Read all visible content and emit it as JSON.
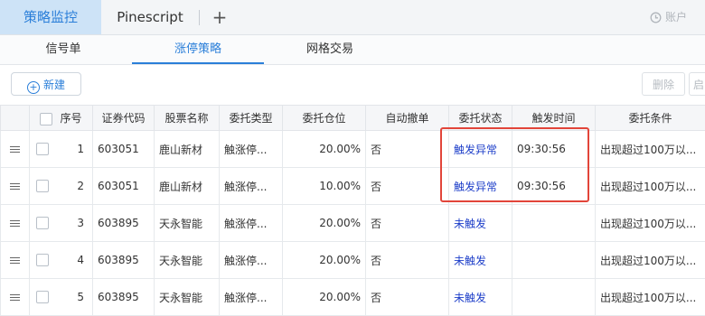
{
  "tabs": {
    "active_label": "策略监控",
    "pine_label": "Pinescript",
    "add_label": "+",
    "account_label": "账户"
  },
  "subtabs": [
    "信号单",
    "涨停策略",
    "网格交易"
  ],
  "toolbar": {
    "new_label": "新建",
    "delete_label": "删除",
    "partial_label": "启"
  },
  "table": {
    "headers": [
      "",
      "序号",
      "证券代码",
      "股票名称",
      "委托类型",
      "委托仓位",
      "自动撤单",
      "委托状态",
      "触发时间",
      "委托条件"
    ],
    "rows": [
      {
        "no": "1",
        "code": "603051",
        "name": "鹿山新材",
        "type": "触涨停...",
        "position": "20.00%",
        "auto_cancel": "否",
        "status": "触发异常",
        "time": "09:30:56",
        "condition": "出现超过100万以..."
      },
      {
        "no": "2",
        "code": "603051",
        "name": "鹿山新材",
        "type": "触涨停...",
        "position": "10.00%",
        "auto_cancel": "否",
        "status": "触发异常",
        "time": "09:30:56",
        "condition": "出现超过100万以..."
      },
      {
        "no": "3",
        "code": "603895",
        "name": "天永智能",
        "type": "触涨停...",
        "position": "20.00%",
        "auto_cancel": "否",
        "status": "未触发",
        "time": "",
        "condition": "出现超过100万以..."
      },
      {
        "no": "4",
        "code": "603895",
        "name": "天永智能",
        "type": "触涨停...",
        "position": "20.00%",
        "auto_cancel": "否",
        "status": "未触发",
        "time": "",
        "condition": "出现超过100万以..."
      },
      {
        "no": "5",
        "code": "603895",
        "name": "天永智能",
        "type": "触涨停...",
        "position": "20.00%",
        "auto_cancel": "否",
        "status": "未触发",
        "time": "",
        "condition": "出现超过100万以..."
      }
    ]
  },
  "colors": {
    "accent": "#2b7fd9",
    "status_text": "#1e3fc9",
    "highlight_border": "#e2453a"
  }
}
